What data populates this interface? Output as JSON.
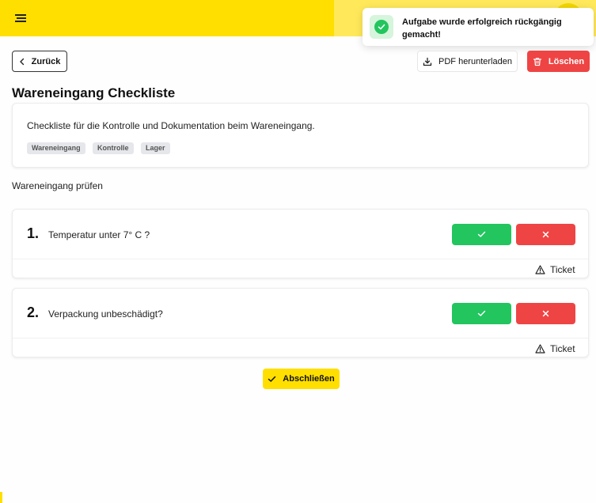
{
  "header": {
    "menu_icon": "hamburger-menu-icon",
    "brand_color": "#ffdf00"
  },
  "toast": {
    "message": "Aufgabe wurde erfolgreich rückgängig gemacht!",
    "icon": "check-circle-icon",
    "color": "#22c55e"
  },
  "toolbar": {
    "back_label": "Zurück",
    "pdf_label": "PDF herunterladen",
    "delete_label": "Löschen",
    "delete_color": "#ef4444"
  },
  "page": {
    "title": "Wareneingang Checkliste",
    "description": "Checkliste für die Kontrolle und Dokumentation beim Wareneingang.",
    "tags": [
      "Wareneingang",
      "Kontrolle",
      "Lager"
    ]
  },
  "section": {
    "title": "Wareneingang prüfen"
  },
  "questions": [
    {
      "number": "1.",
      "text": "Temperatur unter 7° C ?",
      "ticket_label": "Ticket"
    },
    {
      "number": "2.",
      "text": "Verpackung unbeschädigt?",
      "ticket_label": "Ticket"
    }
  ],
  "actions": {
    "finish_label": "Abschließen",
    "yes_color": "#22c55e",
    "no_color": "#ef4444"
  }
}
